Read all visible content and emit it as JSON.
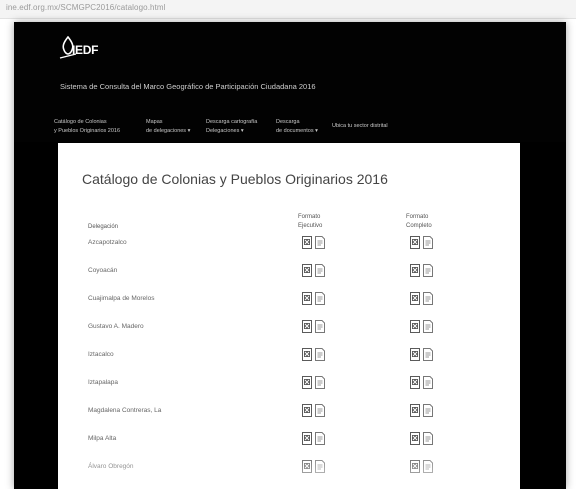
{
  "browser": {
    "url": "ine.edf.org.mx/SCMGPC2016/catalogo.html"
  },
  "header": {
    "logo_text": "IEDF",
    "system_title": "Sistema de Consulta del Marco Geográfico de Participación Ciudadana 2016"
  },
  "nav": {
    "items": [
      {
        "line1": "Catálogo de Colonias",
        "line2": "y Pueblos Originarios 2016"
      },
      {
        "line1": "Mapas",
        "line2": "de delegaciones ▾"
      },
      {
        "line1": "Descarga cartografía",
        "line2": "Delegaciones ▾"
      },
      {
        "line1": "Descarga",
        "line2": "de documentos ▾"
      },
      {
        "line1": "Ubica tu sector distrital",
        "line2": ""
      }
    ]
  },
  "catalog": {
    "title": "Catálogo de Colonias y Pueblos Originarios 2016",
    "col_delegacion": "Delegación",
    "col_ejecutivo": {
      "line1": "Formato",
      "line2": "Ejecutivo"
    },
    "col_completo": {
      "line1": "Formato",
      "line2": "Completo"
    },
    "rows": [
      {
        "name": "Azcapotzalco"
      },
      {
        "name": "Coyoacán"
      },
      {
        "name": "Cuajimalpa de Morelos"
      },
      {
        "name": "Gustavo A. Madero"
      },
      {
        "name": "Iztacalco"
      },
      {
        "name": "Iztapalapa"
      },
      {
        "name": "Magdalena Contreras, La"
      },
      {
        "name": "Milpa Alta"
      },
      {
        "name": "Álvaro Obregón"
      }
    ]
  },
  "colors": {
    "header_bg": "#020202",
    "xls_icon": "#5a5a5a",
    "pdf_icon": "#777777"
  },
  "icons": {
    "xls": "spreadsheet-icon",
    "pdf": "document-icon"
  }
}
